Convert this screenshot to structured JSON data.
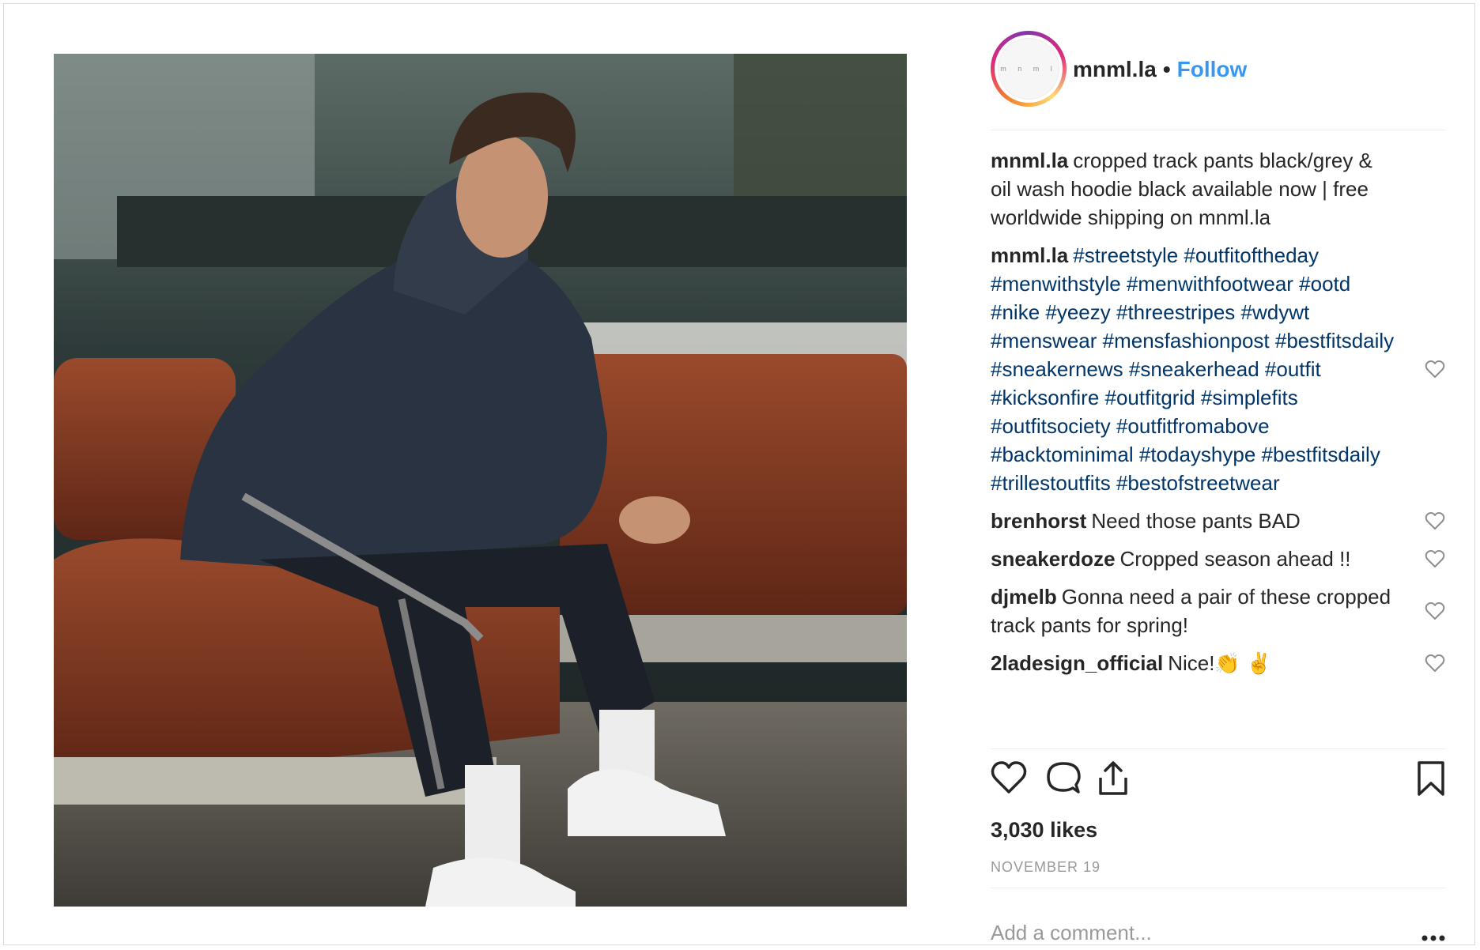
{
  "photo": {
    "label": "product photo"
  },
  "account": {
    "avatar_text": "m n m l",
    "handle": "mnml.la",
    "follow_label": "Follow",
    "separator": "•"
  },
  "comments": [
    {
      "user": "mnml.la",
      "text": "cropped track pants black/grey & oil wash hoodie black available now | free worldwide shipping on mnml.la",
      "heart": false
    },
    {
      "user": "mnml.la",
      "text": "#streetstyle #outfitoftheday #menwithstyle #menwithfootwear #ootd #nike #yeezy #threestripes #wdywt #menswear #mensfashionpost #bestfitsdaily #sneakernews #sneakerhead #outfit #kicksonfire #outfitgrid #simplefits #outfitsociety #outfitfromabove #backtominimal #todayshype #bestfitsdaily #trillestoutfits #bestofstreetwear",
      "heart": true,
      "hashtags": true
    },
    {
      "user": "brenhorst",
      "text": "Need those pants BAD",
      "heart": true
    },
    {
      "user": "sneakerdoze",
      "text": "Cropped season ahead !!",
      "heart": true
    },
    {
      "user": "djmelb",
      "text": "Gonna need a pair of these cropped track pants for spring!",
      "heart": true
    },
    {
      "user": "2ladesign_official",
      "text": "Nice!👏 ✌️",
      "heart": true
    }
  ],
  "actions": {
    "like_icon": "heart-icon",
    "comment_icon": "comment-icon",
    "share_icon": "share-icon",
    "save_icon": "bookmark-icon"
  },
  "likes": "3,030 likes",
  "date": "NOVEMBER 19",
  "add_comment": {
    "placeholder": "Add a comment..."
  },
  "colors": {
    "link": "#3897f0",
    "hashtag": "#003569",
    "muted": "#999999",
    "text": "#262626"
  }
}
